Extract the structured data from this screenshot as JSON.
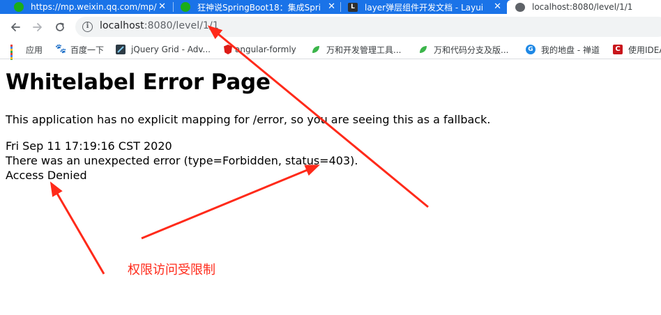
{
  "browser": {
    "tabs": [
      {
        "title": "https://mp.weixin.qq.com/mp/",
        "close": "✕",
        "favicon": "wechat-favicon"
      },
      {
        "title": "狂神说SpringBoot18：集成Spri",
        "close": "✕",
        "favicon": "wechat-favicon"
      },
      {
        "title": "layer弹层组件开发文档 - Layui",
        "close": "✕",
        "favicon": "layui-favicon"
      },
      {
        "title": "localhost:8080/level/1/1",
        "close": "✕",
        "favicon": "globe-favicon"
      }
    ],
    "address": {
      "host": "localhost",
      "path": ":8080/level/1/1"
    },
    "bookmarks": [
      {
        "label": "应用",
        "icon": "apps-grid-icon"
      },
      {
        "label": "百度一下",
        "icon": "baidu-paw-icon"
      },
      {
        "label": "jQuery Grid - Adv...",
        "icon": "jqgrid-icon"
      },
      {
        "label": "angular-formly",
        "icon": "angular-icon"
      },
      {
        "label": "万和开发管理工具...",
        "icon": "leaf-icon"
      },
      {
        "label": "万和代码分支及版...",
        "icon": "leaf-icon"
      },
      {
        "label": "我的地盘 - 禅道",
        "icon": "zentao-icon"
      },
      {
        "label": "使用IDEA",
        "icon": "csdn-icon"
      }
    ]
  },
  "page": {
    "title": "Whitelabel Error Page",
    "message": "This application has no explicit mapping for /error, so you are seeing this as a fallback.",
    "timestamp": "Fri Sep 11 17:19:16 CST 2020",
    "error": "There was an unexpected error (type=Forbidden, status=403).",
    "detail": "Access Denied"
  },
  "annotation": {
    "note": "权限访问受限制",
    "color": "#ff2a1a"
  },
  "colors": {
    "tabstrip": "#1a73e8",
    "omnibox": "#f1f3f4"
  }
}
